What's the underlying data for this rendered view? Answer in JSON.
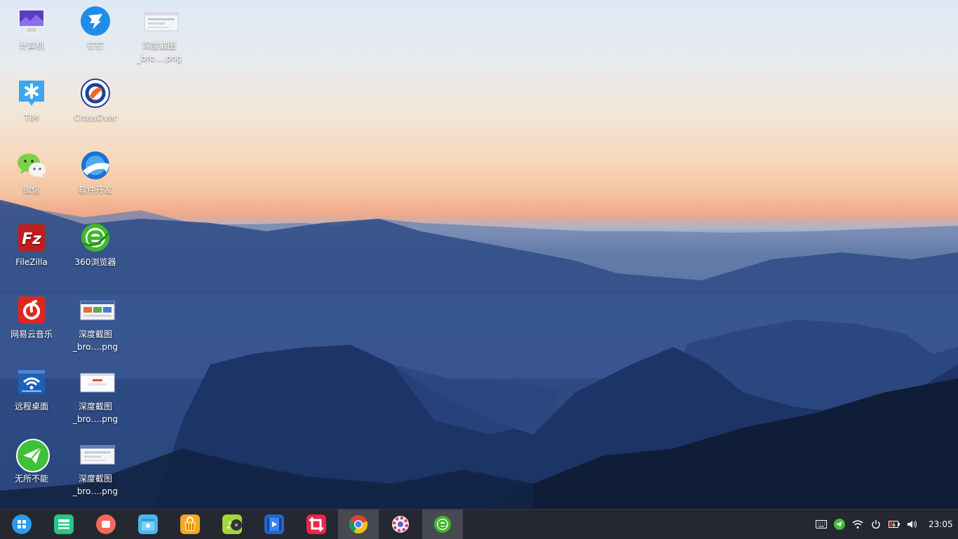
{
  "desktop": {
    "icons": [
      {
        "label": "计算机"
      },
      {
        "label": "钉钉"
      },
      {
        "label": "深度截图\n_bro….png"
      },
      {
        "label": "TIM"
      },
      {
        "label": "CrossOver"
      },
      {
        "label": "微信"
      },
      {
        "label": "软件开发"
      },
      {
        "label": "FileZilla"
      },
      {
        "label": "360浏览器"
      },
      {
        "label": "网易云音乐"
      },
      {
        "label": "深度截图\n_bro….png"
      },
      {
        "label": "远程桌面"
      },
      {
        "label": "深度截图\n_bro….png"
      },
      {
        "label": "无所不能"
      },
      {
        "label": "深度截图\n_bro….png"
      }
    ]
  },
  "taskbar": {
    "apps": [
      {
        "icon": "launcher-icon"
      },
      {
        "icon": "multitasking-icon"
      },
      {
        "icon": "screen-recorder-icon"
      },
      {
        "icon": "file-manager-icon"
      },
      {
        "icon": "app-store-icon"
      },
      {
        "icon": "music-icon"
      },
      {
        "icon": "movie-icon"
      },
      {
        "icon": "screenshot-icon"
      },
      {
        "icon": "chrome-icon"
      },
      {
        "icon": "settings-icon"
      },
      {
        "icon": "360-browser-icon"
      }
    ],
    "clock": "23:05"
  }
}
